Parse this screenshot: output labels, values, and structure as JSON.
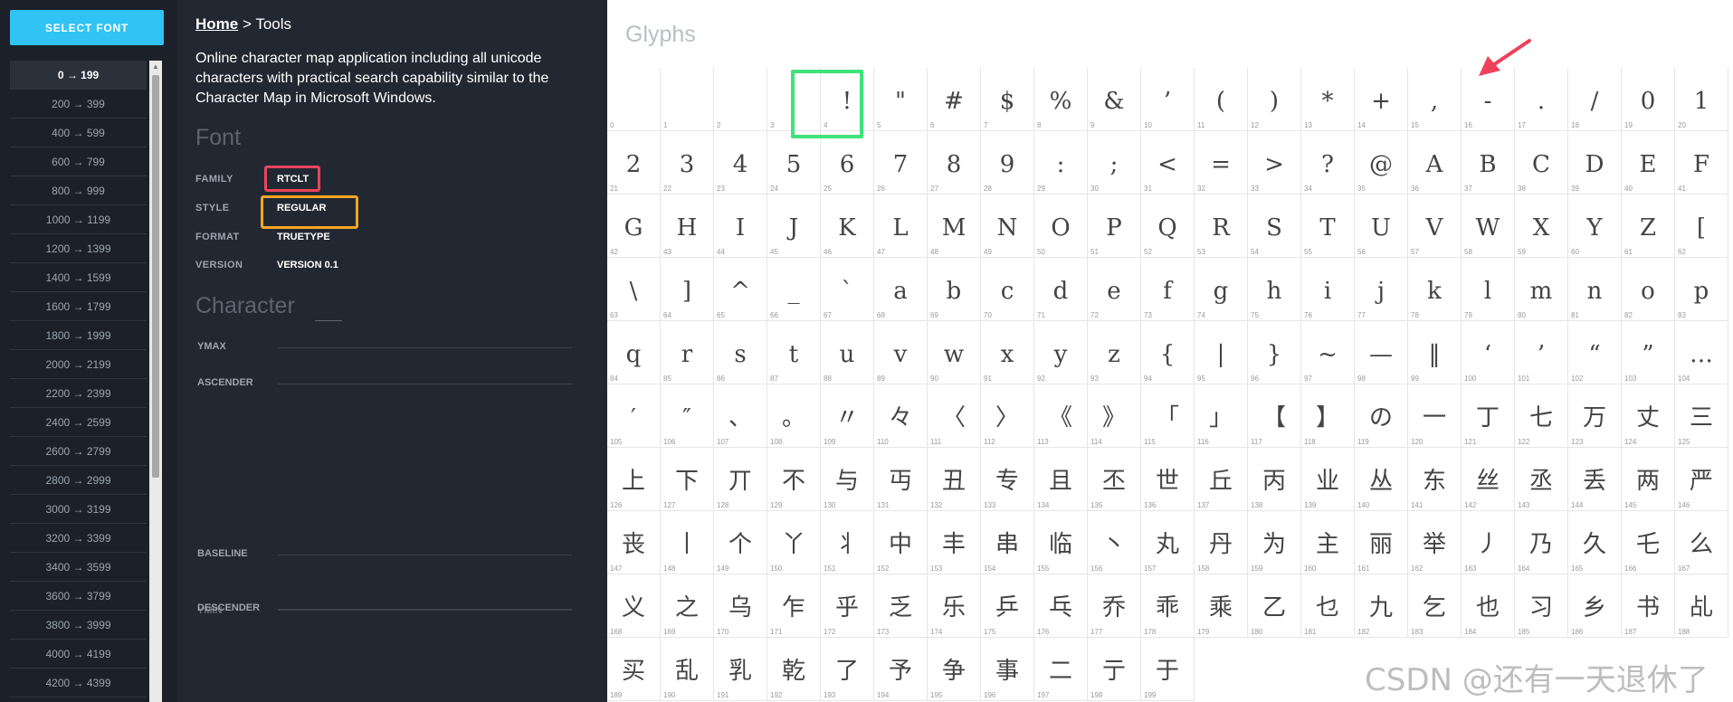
{
  "sidebar": {
    "select_font_label": "SELECT FONT",
    "ranges": [
      "0 → 199",
      "200 → 399",
      "400 → 599",
      "600 → 799",
      "800 → 999",
      "1000 → 1199",
      "1200 → 1399",
      "1400 → 1599",
      "1600 → 1799",
      "1800 → 1999",
      "2000 → 2199",
      "2200 → 2399",
      "2400 → 2599",
      "2600 → 2799",
      "2800 → 2999",
      "3000 → 3199",
      "3200 → 3399",
      "3400 → 3599",
      "3600 → 3799",
      "3800 → 3999",
      "4000 → 4199",
      "4200 → 4399"
    ],
    "active_range": "0 → 199"
  },
  "breadcrumb": {
    "home": "Home",
    "separator": " > ",
    "current": "Tools"
  },
  "description": "Online character map application including all unicode characters with practical search capability similar to the Character Map in Microsoft Windows.",
  "font_section": {
    "title": "Font",
    "properties": [
      {
        "label": "FAMILY",
        "value": "RTCLT",
        "highlight": "#e9445c"
      },
      {
        "label": "STYLE",
        "value": "REGULAR",
        "highlight": "#f5a623"
      },
      {
        "label": "FORMAT",
        "value": "TRUETYPE",
        "highlight": ""
      },
      {
        "label": "VERSION",
        "value": "VERSION 0.1",
        "highlight": ""
      }
    ]
  },
  "character_section": {
    "title": "Character",
    "metrics": [
      {
        "label": "YMAX"
      },
      {
        "label": "ASCENDER"
      },
      {
        "label": "BASELINE"
      },
      {
        "label": "DESCENDER",
        "overlap_label": "YMIN"
      }
    ]
  },
  "glyphs": {
    "title": "Glyphs",
    "selected_index": 15,
    "highlight_color": "#3ee37a",
    "arrow_color": "#f0405a",
    "items": [
      "",
      "",
      "",
      "",
      "!",
      "\"",
      "#",
      "$",
      "%",
      "&",
      "’",
      "(",
      ")",
      "*",
      "+",
      ",",
      "-",
      ".",
      "/",
      "0",
      "1",
      "2",
      "3",
      "4",
      "5",
      "6",
      "7",
      "8",
      "9",
      ":",
      ";",
      "<",
      "=",
      ">",
      "?",
      "@",
      "A",
      "B",
      "C",
      "D",
      "E",
      "F",
      "G",
      "H",
      "I",
      "J",
      "K",
      "L",
      "M",
      "N",
      "O",
      "P",
      "Q",
      "R",
      "S",
      "T",
      "U",
      "V",
      "W",
      "X",
      "Y",
      "Z",
      "[",
      "\\",
      "]",
      "^",
      "_",
      "`",
      "a",
      "b",
      "c",
      "d",
      "e",
      "f",
      "g",
      "h",
      "i",
      "j",
      "k",
      "l",
      "m",
      "n",
      "o",
      "p",
      "q",
      "r",
      "s",
      "t",
      "u",
      "v",
      "w",
      "x",
      "y",
      "z",
      "{",
      "|",
      "}",
      "~",
      "—",
      "‖",
      "‘",
      "’",
      "“",
      "”",
      "…",
      "′",
      "″",
      "、",
      "。",
      "〃",
      "々",
      "〈",
      "〉",
      "《",
      "》",
      "「",
      "」",
      "【",
      "】",
      "の",
      "一",
      "丁",
      "七",
      "万",
      "丈",
      "三",
      "上",
      "下",
      "丌",
      "不",
      "与",
      "丏",
      "丑",
      "专",
      "且",
      "丕",
      "世",
      "丘",
      "丙",
      "业",
      "丛",
      "东",
      "丝",
      "丞",
      "丢",
      "两",
      "严",
      "丧",
      "丨",
      "个",
      "丫",
      "丬",
      "中",
      "丰",
      "串",
      "临",
      "丶",
      "丸",
      "丹",
      "为",
      "主",
      "丽",
      "举",
      "丿",
      "乃",
      "久",
      "乇",
      "么",
      "义",
      "之",
      "乌",
      "乍",
      "乎",
      "乏",
      "乐",
      "乒",
      "乓",
      "乔",
      "乖",
      "乘",
      "乙",
      "乜",
      "九",
      "乞",
      "也",
      "习",
      "乡",
      "书",
      "乩",
      "买",
      "乱",
      "乳",
      "乾",
      "了",
      "予",
      "争",
      "事",
      "二",
      "亍",
      "于"
    ]
  },
  "watermark": "CSDN @还有一天退休了"
}
